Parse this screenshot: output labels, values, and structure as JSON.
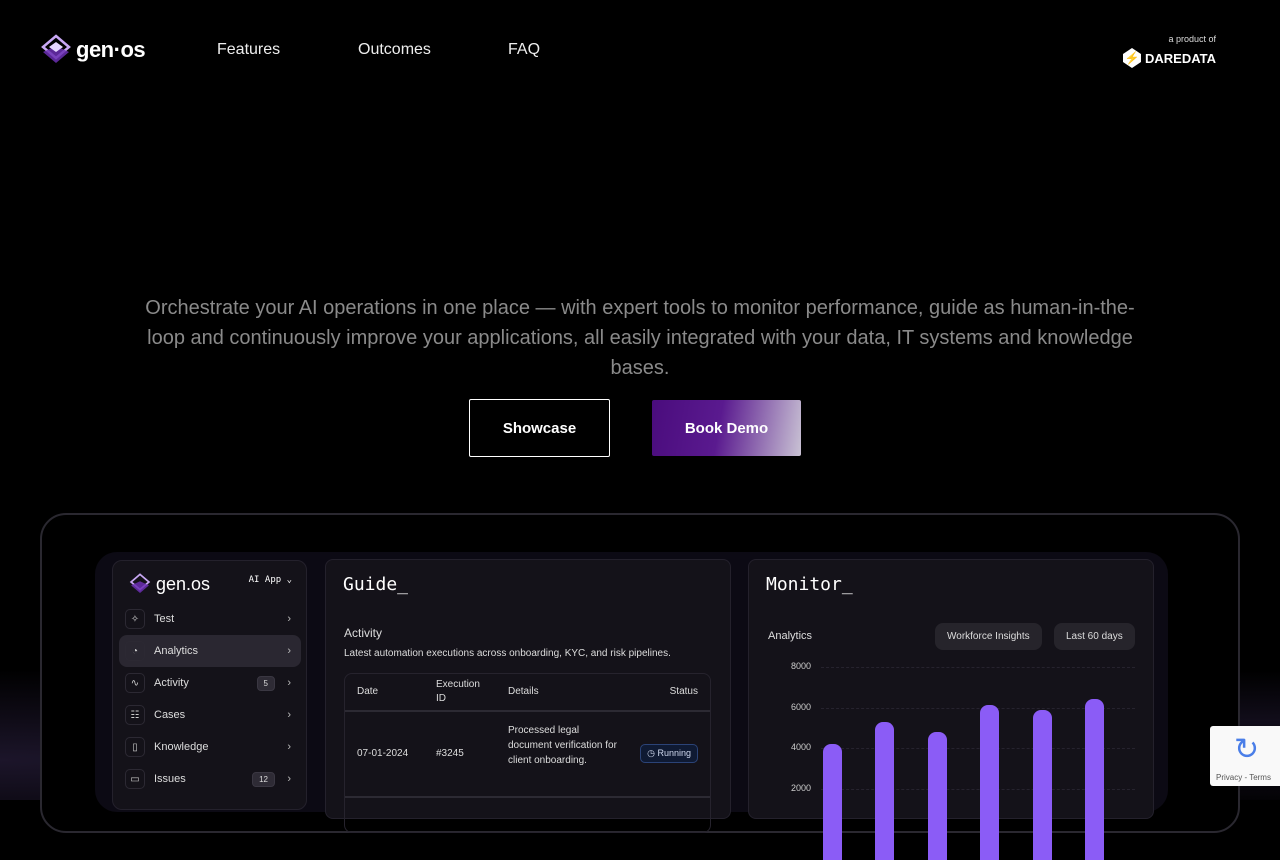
{
  "nav": {
    "brand": "gen·os",
    "links": [
      "Features",
      "Outcomes",
      "FAQ"
    ],
    "product_of": "a product of",
    "partner": "DAREDATA"
  },
  "hero": {
    "text": "Orchestrate your AI operations in one place — with expert tools to monitor performance, guide as human-in-the-loop and continuously improve your applications, all easily integrated with your data, IT systems and knowledge bases.",
    "showcase": "Showcase",
    "book_demo": "Book Demo"
  },
  "app": {
    "brand": "gen.os",
    "app_select": "AI App",
    "sidebar": [
      {
        "label": "Test",
        "icon": "sparkles-icon"
      },
      {
        "label": "Analytics",
        "icon": "pie-chart-icon",
        "active": true
      },
      {
        "label": "Activity",
        "icon": "activity-icon",
        "badge": "5"
      },
      {
        "label": "Cases",
        "icon": "list-icon"
      },
      {
        "label": "Knowledge",
        "icon": "book-icon"
      },
      {
        "label": "Issues",
        "icon": "folder-icon",
        "badge": "12"
      }
    ],
    "guide": {
      "title": "Guide_",
      "section": "Activity",
      "description": "Latest automation executions across onboarding, KYC, and risk pipelines.",
      "columns": [
        "Date",
        "Execution ID",
        "Details",
        "Status"
      ],
      "rows": [
        {
          "date": "07-01-2024",
          "id": "#3245",
          "details": "Processed legal document verification for client onboarding.",
          "status": "Running"
        }
      ]
    },
    "monitor": {
      "title": "Monitor_",
      "section": "Analytics",
      "chip1": "Workforce Insights",
      "chip2": "Last 60 days"
    }
  },
  "chart_data": {
    "type": "bar",
    "title": "Analytics",
    "yticks": [
      "8000",
      "6000",
      "4000",
      "2000"
    ],
    "ylim": [
      0,
      8000
    ],
    "values": [
      4200,
      5300,
      4800,
      6100,
      5900,
      6400
    ],
    "color": "#8b5cf6"
  },
  "recaptcha": {
    "text": "Privacy - Terms"
  }
}
